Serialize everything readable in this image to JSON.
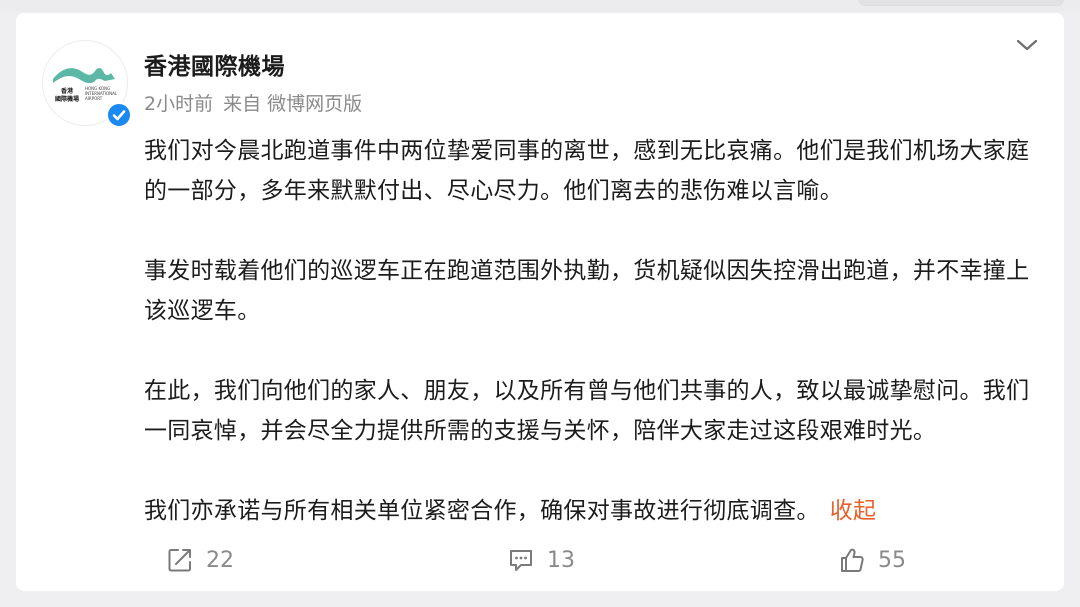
{
  "post": {
    "author": "香港國際機場",
    "time": "2小时前",
    "source": "来自 微博网页版",
    "paragraphs": [
      "我们对今晨北跑道事件中两位挚爱同事的离世，感到无比哀痛。他们是我们机场大家庭的一部分，多年来默默付出、尽心尽力。他们离去的悲伤难以言喻。",
      "事发时载着他们的巡逻车正在跑道范围外执勤，货机疑似因失控滑出跑道，并不幸撞上该巡逻车。",
      "在此，我们向他们的家人、朋友，以及所有曾与他们共事的人，致以最诚挚慰问。我们一同哀悼，并会尽全力提供所需的支援与关怀，陪伴大家走过这段艰难时光。",
      "我们亦承诺与所有相关单位紧密合作，确保对事故进行彻底调查。"
    ],
    "collapse_label": "收起"
  },
  "avatar": {
    "logo_zh": "香港國際機場",
    "logo_en": "HONG KONG INTERNATIONAL AIRPORT",
    "logo_color": "#5bb8a6"
  },
  "actions": {
    "repost": {
      "icon": "share-icon",
      "count": "22"
    },
    "comment": {
      "icon": "comment-icon",
      "count": "13"
    },
    "like": {
      "icon": "thumbs-up-icon",
      "count": "55"
    }
  },
  "colors": {
    "accent_link": "#e8612c",
    "verified_badge": "#1a8af0",
    "meta_text": "#8a8a8a"
  }
}
